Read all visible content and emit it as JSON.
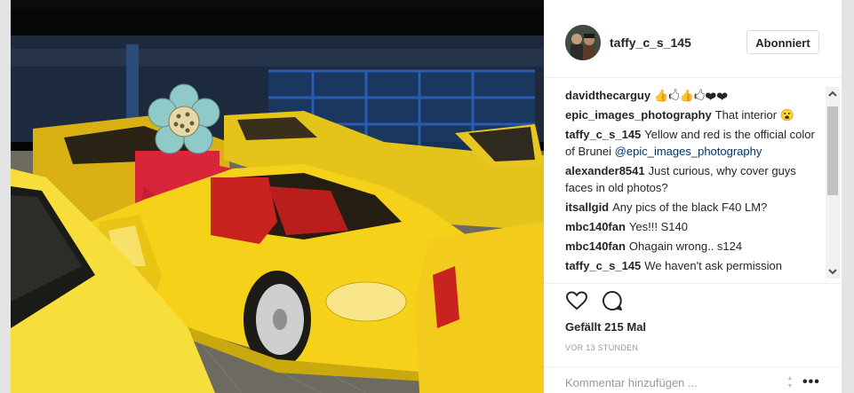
{
  "post": {
    "username": "taffy_c_s_145",
    "follow_label": "Abonniert",
    "likes": "Gefällt 215 Mal",
    "timestamp": "VOR 13 STUNDEN",
    "comment_placeholder": "Kommentar hinzufügen ...",
    "more_label": "•••"
  },
  "comments": [
    {
      "user": "davidthecarguy",
      "text": "👍🖒👍🖒❤❤",
      "mention": ""
    },
    {
      "user": "epic_images_photography",
      "text": "That interior 😮",
      "mention": ""
    },
    {
      "user": "taffy_c_s_145",
      "text": "Yellow and red is the official color of Brunei",
      "mention": "@epic_images_photography"
    },
    {
      "user": "alexander8541",
      "text": "Just curious, why cover guys faces in old photos?",
      "mention": ""
    },
    {
      "user": "itsallgid",
      "text": "Any pics of the black F40 LM?",
      "mention": ""
    },
    {
      "user": "mbc140fan",
      "text": "Yes!!! S140",
      "mention": ""
    },
    {
      "user": "mbc140fan",
      "text": "Ohagain wrong.. s124",
      "mention": ""
    },
    {
      "user": "taffy_c_s_145",
      "text": "We haven't ask permission",
      "mention": ""
    }
  ],
  "icons": {
    "like": "heart-icon",
    "comment": "comment-bubble-icon",
    "scroll_up": "chevron-up-icon",
    "scroll_down": "chevron-down-icon",
    "more": "more-options-icon"
  },
  "colors": {
    "car_yellow": "#f6d11a",
    "interior_red": "#c8231f",
    "flower_sticker": "#8fc9c8",
    "mention_blue": "#003569"
  }
}
